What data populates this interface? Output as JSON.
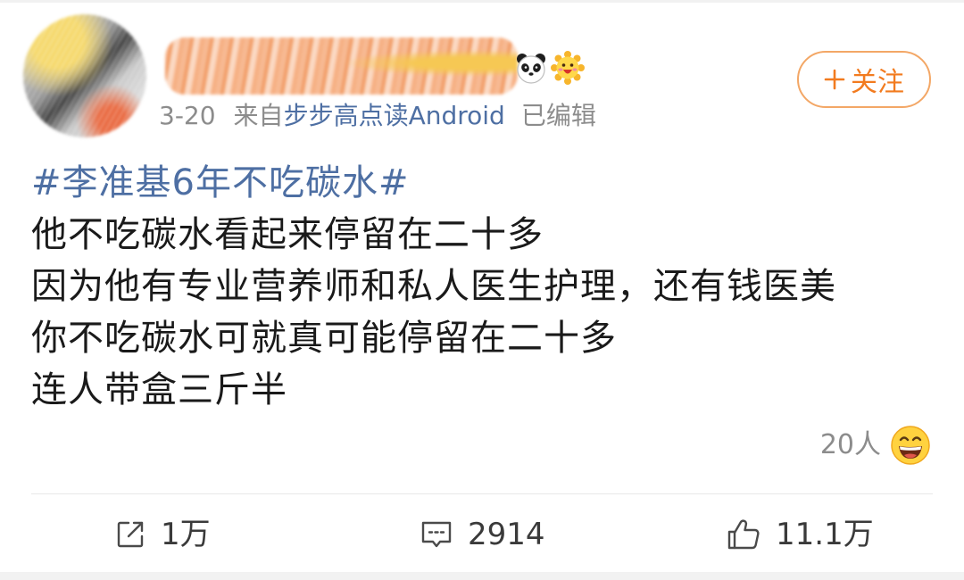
{
  "post": {
    "author": {
      "avatar_icon": "avatar-obscured",
      "badges": [
        "panda-face-icon",
        "sunflower-face-icon"
      ]
    },
    "meta": {
      "date": "3-20",
      "source_prefix": "来自",
      "source": "步步高点读Android",
      "edited": "已编辑"
    },
    "follow": {
      "icon": "plus-icon",
      "label": "关注"
    },
    "hashtag": "#李准基6年不吃碳水#",
    "lines": [
      "他不吃碳水看起来停留在二十多",
      "因为他有专业营养师和私人医生护理，还有钱医美",
      "你不吃碳水可就真可能停留在二十多",
      "连人带盒三斤半"
    ],
    "reaction": {
      "count": "20人",
      "icon": "grinning-face-icon"
    }
  },
  "actions": [
    {
      "icon": "share-icon",
      "count": "1万"
    },
    {
      "icon": "comment-icon",
      "count": "2914"
    },
    {
      "icon": "like-icon",
      "count": "11.1万"
    }
  ],
  "colors": {
    "link": "#4e6fa3",
    "accent": "#f27b1f",
    "accent_border": "#f3a766",
    "text": "#1a1a1a",
    "muted": "#8c8c8c",
    "action": "#3a3a3a",
    "divider": "#e8e8e8"
  }
}
